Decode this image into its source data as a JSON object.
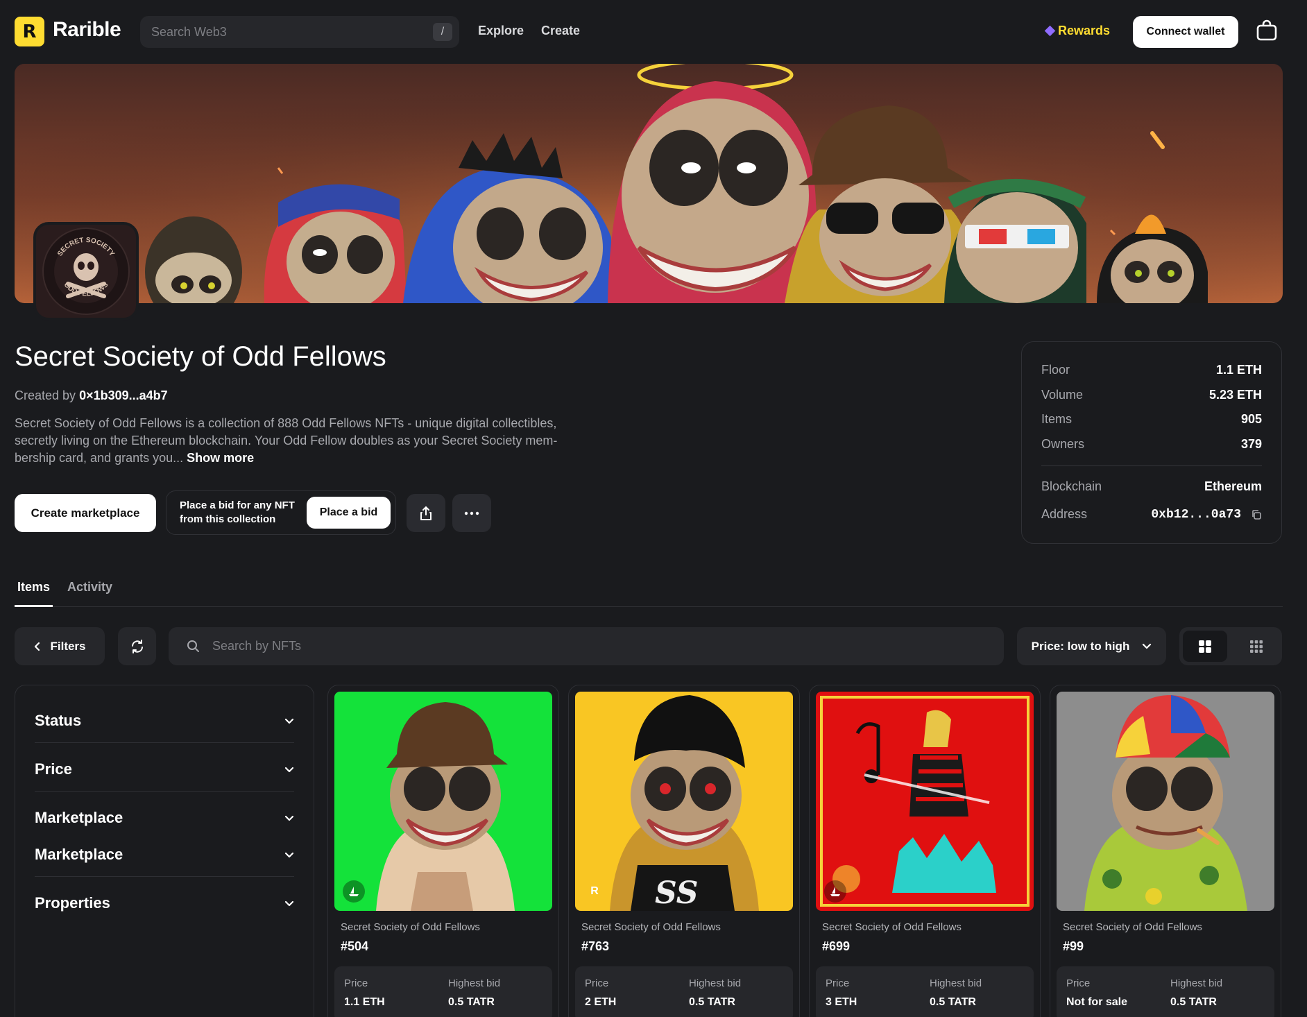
{
  "header": {
    "logo_letter": "R",
    "brand": "Rarible",
    "search_placeholder": "Search Web3",
    "search_shortcut": "/",
    "nav": [
      "Explore",
      "Create"
    ],
    "rewards": "Rewards",
    "connect_wallet": "Connect wallet"
  },
  "collection": {
    "title": "Secret Society of Odd Fellows",
    "created_by_label": "Created by",
    "creator": "0×1b309...a4b7",
    "description": "Secret Society of Odd Fellows is a collection of 888 Odd Fellows NFTs - unique digital collectibles, secretly living on the Ethereum blockchain. Your Odd Fellow doubles as your Secret Society mem­bership card, and grants you...",
    "show_more": "Show more",
    "avatar_text_top": "SECRET SOCIETY",
    "avatar_text_bottom": "ODD FELLOWS"
  },
  "actions": {
    "create_marketplace": "Create marketplace",
    "bid_text": "Place a bid for any NFT from this collection",
    "place_bid": "Place a bid"
  },
  "stats": {
    "rows": [
      {
        "k": "Floor",
        "v": "1.1 ETH"
      },
      {
        "k": "Volume",
        "v": "5.23 ETH"
      },
      {
        "k": "Items",
        "v": "905"
      },
      {
        "k": "Owners",
        "v": "379"
      }
    ],
    "blockchain_label": "Blockchain",
    "blockchain": "Ethereum",
    "address_label": "Address",
    "address": "0xb12...0a73"
  },
  "tabs": [
    "Items",
    "Activity"
  ],
  "toolbar": {
    "filters": "Filters",
    "search_placeholder": "Search by NFTs",
    "sort": "Price: low to high"
  },
  "filters": [
    "Status",
    "Price",
    "Marketplace",
    "Marketplace",
    "Properties"
  ],
  "cards": [
    {
      "collection": "Secret Society of Odd Fellows",
      "name": "#504",
      "price_label": "Price",
      "price": "1.1 ETH",
      "bid_label": "Highest bid",
      "bid": "0.5 TATR",
      "bg": "#14e23a"
    },
    {
      "collection": "Secret Society of Odd Fellows",
      "name": "#763",
      "price_label": "Price",
      "price": "2 ETH",
      "bid_label": "Highest bid",
      "bid": "0.5 TATR",
      "bg": "#f9c623",
      "badge_letter": "R",
      "art_text": "SS"
    },
    {
      "collection": "Secret Society of Odd Fellows",
      "name": "#699",
      "price_label": "Price",
      "price": "3 ETH",
      "bid_label": "Highest bid",
      "bid": "0.5 TATR",
      "bg": "#e01010"
    },
    {
      "collection": "Secret Society of Odd Fellows",
      "name": "#99",
      "price_label": "Price",
      "price": "Not for sale",
      "bid_label": "Highest bid",
      "bid": "0.5 TATR",
      "bg": "#8d8d8d"
    }
  ],
  "colors": {
    "brand": "#fedc31",
    "background": "#1a1b1e",
    "surface": "#26272b",
    "rewards_accent": "#8f6cff"
  }
}
